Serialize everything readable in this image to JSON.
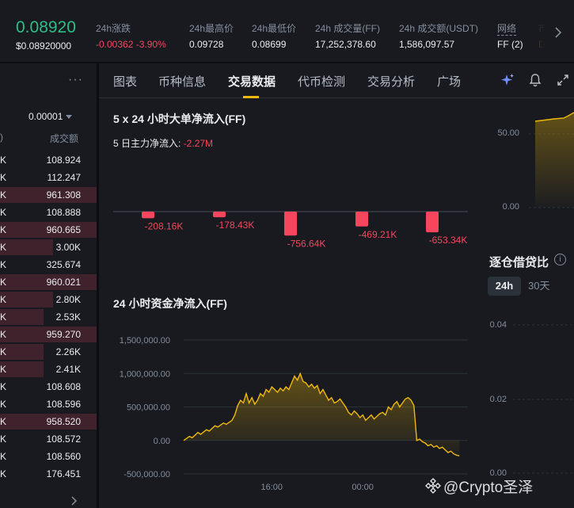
{
  "ticker": {
    "price": "0.08920",
    "price_usd": "$0.08920000",
    "change_label": "24h涨跌",
    "change_value": "-0.00362",
    "change_pct": "-3.90%",
    "high_label": "24h最高价",
    "high_value": "0.09728",
    "low_label": "24h最低价",
    "low_value": "0.08699",
    "vol_ff_label": "24h 成交量(FF)",
    "vol_ff_value": "17,252,378.60",
    "vol_usdt_label": "24h 成交额(USDT)",
    "vol_usdt_value": "1,586,097.57",
    "network_label": "网络",
    "network_value": "FF (2)",
    "cut_label": "市",
    "cut_value": "D"
  },
  "book": {
    "more": "···",
    "precision": "0.00001",
    "col_left": ")",
    "col_right": "成交额",
    "rows": [
      {
        "k": "K",
        "v": "108.924",
        "bar": 0
      },
      {
        "k": "K",
        "v": "112.247",
        "bar": 0
      },
      {
        "k": "K",
        "v": "961.308",
        "bar": 1
      },
      {
        "k": "K",
        "v": "108.888",
        "bar": 0
      },
      {
        "k": "K",
        "v": "960.665",
        "bar": 1
      },
      {
        "k": "K",
        "v": "3.00K",
        "bar": 0.55
      },
      {
        "k": "K",
        "v": "325.674",
        "bar": 0
      },
      {
        "k": "K",
        "v": "960.021",
        "bar": 1
      },
      {
        "k": "K",
        "v": "2.80K",
        "bar": 0.55
      },
      {
        "k": "K",
        "v": "2.53K",
        "bar": 0.45
      },
      {
        "k": "K",
        "v": "959.270",
        "bar": 1
      },
      {
        "k": "K",
        "v": "2.26K",
        "bar": 0.45
      },
      {
        "k": "K",
        "v": "2.41K",
        "bar": 0.45
      },
      {
        "k": "K",
        "v": "108.608",
        "bar": 0
      },
      {
        "k": "K",
        "v": "108.596",
        "bar": 0
      },
      {
        "k": "K",
        "v": "958.520",
        "bar": 1
      },
      {
        "k": "K",
        "v": "108.572",
        "bar": 0
      },
      {
        "k": "K",
        "v": "108.560",
        "bar": 0
      },
      {
        "k": "K",
        "v": "176.451",
        "bar": 0
      }
    ]
  },
  "tabs": [
    "图表",
    "币种信息",
    "交易数据",
    "代币检测",
    "交易分析",
    "广场"
  ],
  "active_tab": "交易数据",
  "icons": [
    "ai-sparkle-icon",
    "bell-icon",
    "expand-icon"
  ],
  "section1": {
    "title": "5 x 24 小时大单净流入(FF)",
    "summary_label": "5 日主力净流入:",
    "summary_value": "-2.27M"
  },
  "section2": {
    "title": "24 小时资金净流入(FF)"
  },
  "right_panel": {
    "title": "逐仓借贷比",
    "period_active": "24h",
    "period_other": "30天",
    "top_ticks": [
      "50.00",
      "0.00"
    ],
    "bottom_ticks": [
      "0.04",
      "0.02",
      "0.00"
    ]
  },
  "watermark": "@Crypto圣泽",
  "colors": {
    "bg": "#0b0e11",
    "panel": "#181a20",
    "up": "#2ebd85",
    "down": "#f6465d",
    "accent": "#f0b90b",
    "muted": "#848e9c"
  },
  "chart_data": [
    {
      "type": "bar",
      "title": "5 x 24 小时大单净流入(FF)",
      "values": [
        -208.16,
        -178.43,
        -756.64,
        -469.21,
        -653.34
      ],
      "value_labels": [
        "-208.16K",
        "-178.43K",
        "-756.64K",
        "-469.21K",
        "-653.34K"
      ],
      "unit": "K",
      "xlabel": "",
      "ylabel": ""
    },
    {
      "type": "area",
      "title": "24 小时资金净流入(FF)",
      "y_ticks": [
        "1,500,000.00",
        "1,000,000.00",
        "500,000.00",
        "0.00",
        "-500,000.00"
      ],
      "ylim": [
        -500000,
        1500000
      ],
      "x_ticks": [
        "16:00",
        "00:00"
      ],
      "xlim": [
        0,
        100
      ],
      "x_tick_positions": [
        31,
        63
      ],
      "series": [
        {
          "values": [
            [
              0,
              0
            ],
            [
              2,
              60000
            ],
            [
              3,
              40000
            ],
            [
              5,
              120000
            ],
            [
              6,
              90000
            ],
            [
              8,
              160000
            ],
            [
              9,
              140000
            ],
            [
              11,
              220000
            ],
            [
              12,
              200000
            ],
            [
              14,
              260000
            ],
            [
              15,
              240000
            ],
            [
              17,
              300000
            ],
            [
              18,
              380000
            ],
            [
              19,
              520000
            ],
            [
              20,
              600000
            ],
            [
              21,
              560000
            ],
            [
              22,
              700000
            ],
            [
              23,
              560000
            ],
            [
              24,
              640000
            ],
            [
              25,
              540000
            ],
            [
              26,
              600000
            ],
            [
              27,
              700000
            ],
            [
              28,
              660000
            ],
            [
              29,
              760000
            ],
            [
              30,
              720000
            ],
            [
              31,
              800000
            ],
            [
              32,
              760000
            ],
            [
              33,
              720000
            ],
            [
              34,
              780000
            ],
            [
              35,
              740000
            ],
            [
              36,
              800000
            ],
            [
              37,
              760000
            ],
            [
              38,
              860000
            ],
            [
              39,
              960000
            ],
            [
              40,
              900000
            ],
            [
              41,
              1000000
            ],
            [
              42,
              880000
            ],
            [
              43,
              860000
            ],
            [
              44,
              800000
            ],
            [
              45,
              840000
            ],
            [
              46,
              780000
            ],
            [
              47,
              820000
            ],
            [
              48,
              700000
            ],
            [
              49,
              760000
            ],
            [
              50,
              680000
            ],
            [
              51,
              600000
            ],
            [
              52,
              640000
            ],
            [
              53,
              560000
            ],
            [
              54,
              580000
            ],
            [
              55,
              620000
            ],
            [
              56,
              560000
            ],
            [
              57,
              500000
            ],
            [
              58,
              420000
            ],
            [
              59,
              380000
            ],
            [
              60,
              440000
            ],
            [
              61,
              400000
            ],
            [
              62,
              340000
            ],
            [
              63,
              380000
            ],
            [
              64,
              300000
            ],
            [
              65,
              340000
            ],
            [
              66,
              380000
            ],
            [
              67,
              320000
            ],
            [
              68,
              360000
            ],
            [
              69,
              400000
            ],
            [
              70,
              420000
            ],
            [
              71,
              380000
            ],
            [
              72,
              500000
            ],
            [
              73,
              460000
            ],
            [
              74,
              540000
            ],
            [
              75,
              580000
            ],
            [
              76,
              500000
            ],
            [
              77,
              560000
            ],
            [
              78,
              620000
            ],
            [
              79,
              640000
            ],
            [
              80,
              600000
            ],
            [
              81,
              520000
            ],
            [
              82,
              0
            ],
            [
              83,
              20000
            ],
            [
              84,
              -20000
            ],
            [
              85,
              -40000
            ],
            [
              86,
              -80000
            ],
            [
              87,
              -60000
            ],
            [
              88,
              -100000
            ],
            [
              89,
              -80000
            ],
            [
              90,
              -120000
            ],
            [
              91,
              -100000
            ],
            [
              92,
              -140000
            ],
            [
              93,
              -180000
            ],
            [
              94,
              -160000
            ],
            [
              95,
              -200000
            ],
            [
              96,
              -220000
            ],
            [
              97,
              -230000
            ]
          ]
        }
      ]
    }
  ]
}
